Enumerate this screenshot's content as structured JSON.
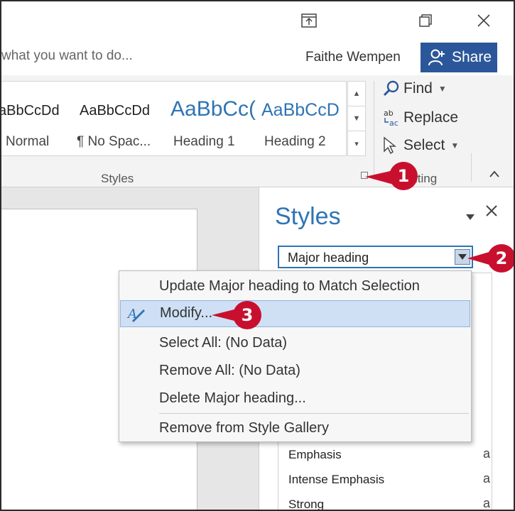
{
  "titlebar": {
    "restore_icon": "ribbon-display-icon",
    "maximize_icon": "restore-window-icon",
    "close_icon": "close-icon"
  },
  "tellme": {
    "placeholder": "what you want to do..."
  },
  "user": {
    "name": "Faithe Wempen"
  },
  "share": {
    "label": "Share",
    "icon": "add-person-icon"
  },
  "ribbon": {
    "gallery": [
      {
        "sample": "aBbCcDd",
        "label": "Normal"
      },
      {
        "sample": "AaBbCcDd",
        "label": "¶ No Spac..."
      },
      {
        "sample": "AaBbCc(",
        "label": "Heading 1"
      },
      {
        "sample": "AaBbCcD",
        "label": "Heading 2"
      }
    ],
    "styles_group_label": "Styles",
    "editing": {
      "find": "Find",
      "replace": "Replace",
      "select": "Select",
      "group_label": "iting"
    }
  },
  "callouts": {
    "one": "1",
    "two": "2",
    "three": "3"
  },
  "pane": {
    "title": "Styles",
    "selected_style": "Major heading",
    "styles": [
      {
        "name": "Emphasis",
        "mark": "a"
      },
      {
        "name": "Intense Emphasis",
        "mark": "a"
      },
      {
        "name": "Strong",
        "mark": "a"
      }
    ]
  },
  "menu": {
    "items": [
      {
        "label": "Update Major heading to Match Selection"
      },
      {
        "label": "Modify..."
      },
      {
        "label": "Select All: (No Data)"
      },
      {
        "label": "Remove All: (No Data)"
      },
      {
        "label": "Delete Major heading..."
      },
      {
        "label": "Remove from Style Gallery"
      }
    ]
  },
  "colors": {
    "accent": "#2b579a",
    "pane_title": "#2e74b5",
    "callout": "#c8102e",
    "highlight": "#cfe0f5"
  }
}
